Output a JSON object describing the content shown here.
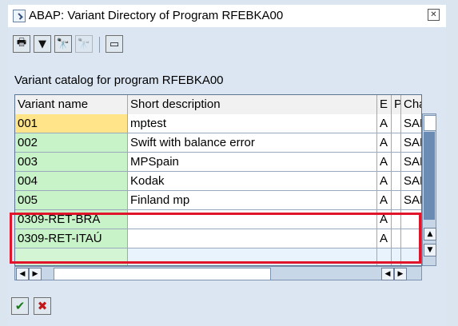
{
  "window": {
    "title": "ABAP: Variant Directory of Program RFEBKA00",
    "close_icon": "close-x-icon"
  },
  "toolbar": {
    "buttons": [
      {
        "name": "print-icon",
        "glyph": "🖶"
      },
      {
        "name": "filter-icon",
        "glyph": "▼"
      },
      {
        "name": "find-icon",
        "glyph": "🔭"
      },
      {
        "name": "find-next-icon",
        "glyph": "🔭"
      },
      {
        "name": "local-file-icon",
        "glyph": "▭"
      }
    ]
  },
  "catalog": {
    "label": "Variant catalog for program RFEBKA00"
  },
  "table": {
    "headers": [
      "Variant name",
      "Short description",
      "E",
      "P",
      "Cha"
    ],
    "rows": [
      {
        "name": "001",
        "desc": "mptest",
        "e": "A",
        "p": "",
        "cha": "SAP"
      },
      {
        "name": "002",
        "desc": "Swift with balance error",
        "e": "A",
        "p": "",
        "cha": "SAP"
      },
      {
        "name": "003",
        "desc": "MPSpain",
        "e": "A",
        "p": "",
        "cha": "SAP"
      },
      {
        "name": "004",
        "desc": "Kodak",
        "e": "A",
        "p": "",
        "cha": "SAP"
      },
      {
        "name": "005",
        "desc": "Finland mp",
        "e": "A",
        "p": "",
        "cha": "SAP"
      },
      {
        "name": "0309-RET-BRA",
        "desc": "",
        "e": "A",
        "p": "",
        "cha": ""
      },
      {
        "name": "0309-RET-ITAÚ",
        "desc": "",
        "e": "A",
        "p": "",
        "cha": ""
      },
      {
        "name": "",
        "desc": "",
        "e": "",
        "p": "",
        "cha": ""
      }
    ]
  },
  "actions": {
    "ok": "✔",
    "cancel": "✖"
  },
  "colors": {
    "highlight": "#e0152b",
    "selected_cell": "#ffe48a",
    "name_cell": "#c8f2c8"
  }
}
